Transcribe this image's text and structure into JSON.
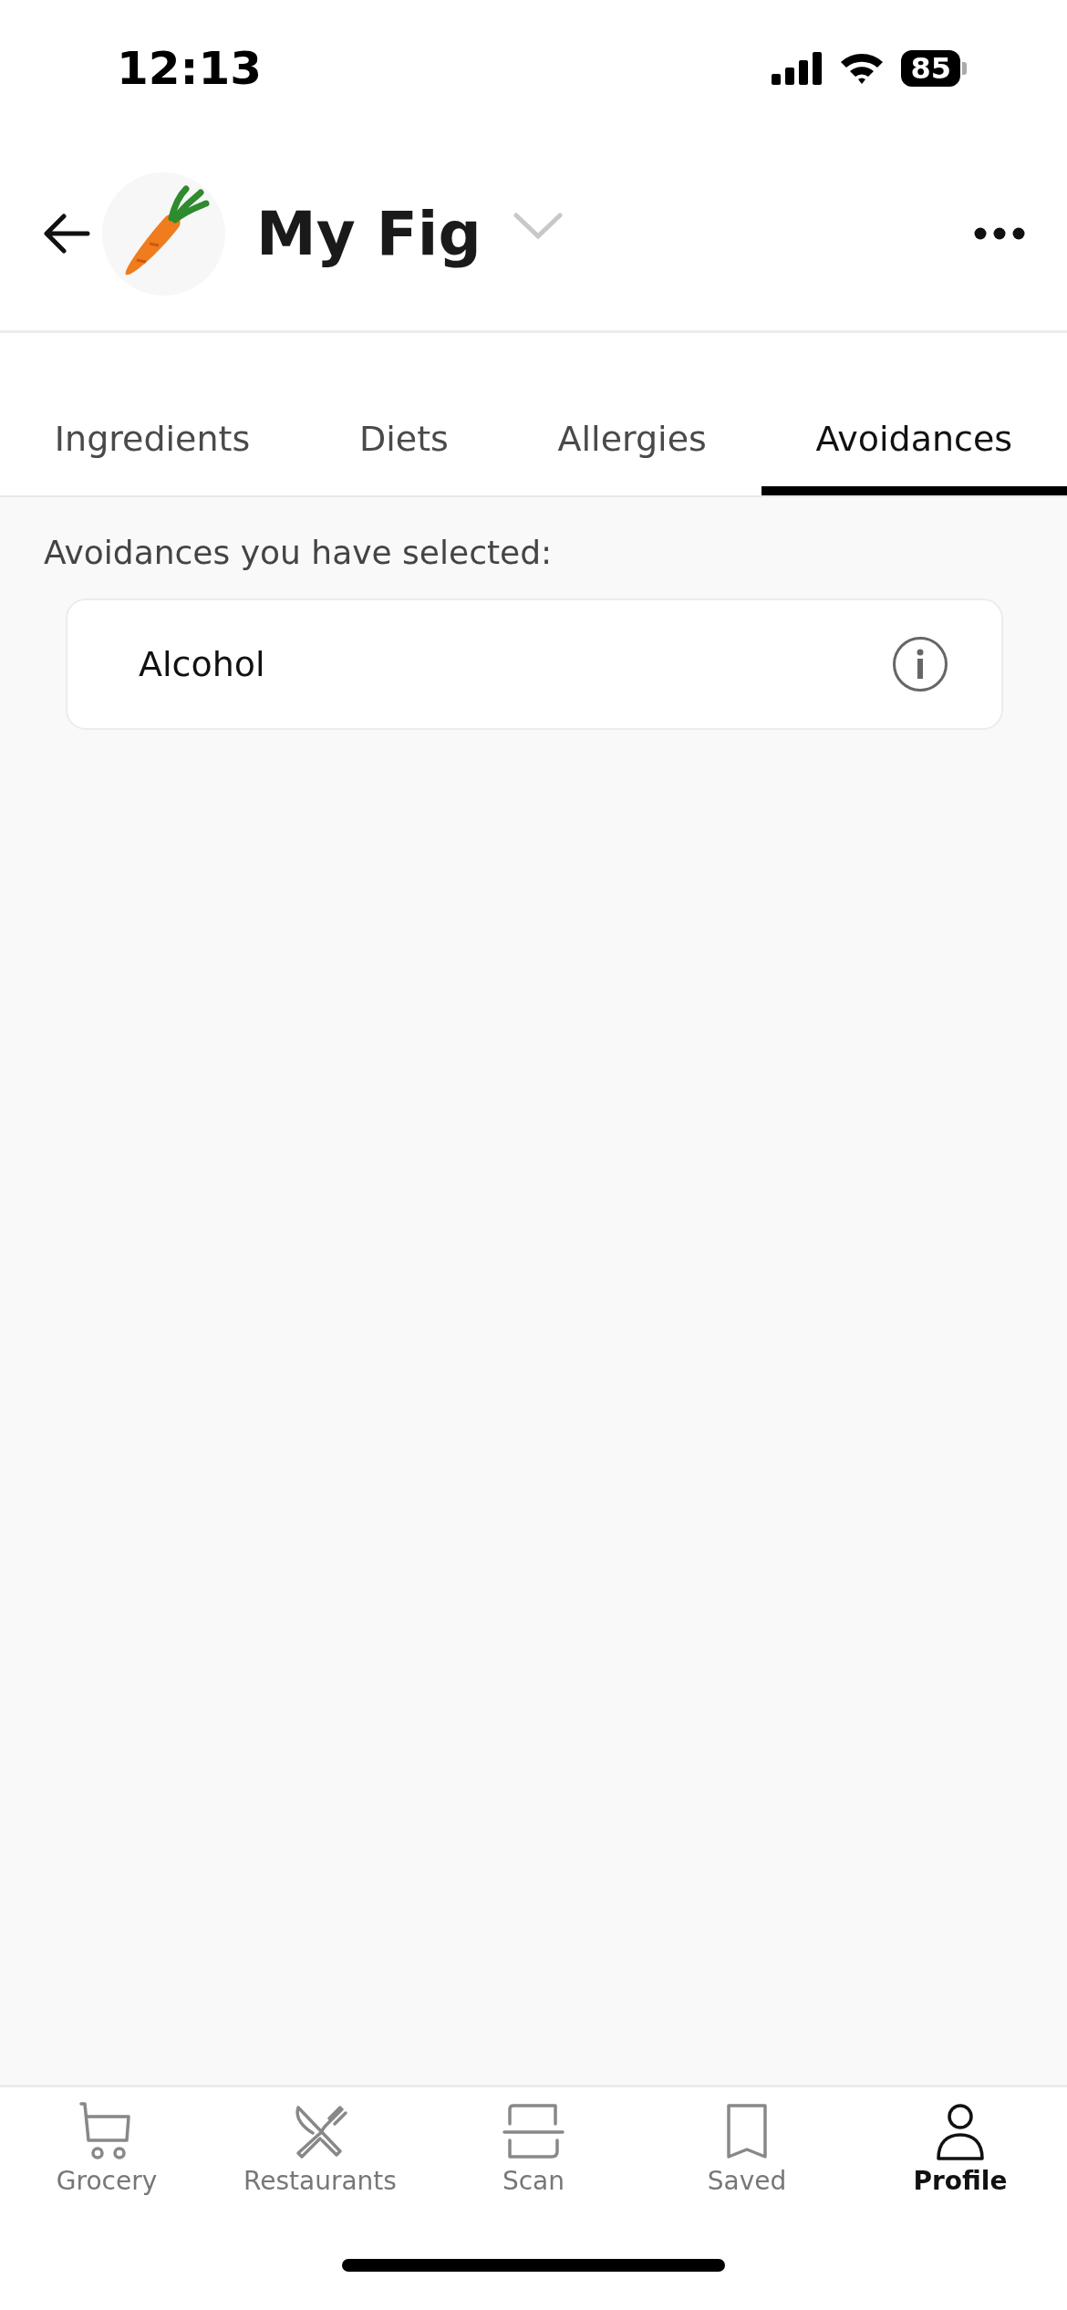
{
  "status_bar": {
    "time": "12:13",
    "battery": "85"
  },
  "header": {
    "title": "My Fig"
  },
  "tabs": [
    {
      "label": "Ingredients",
      "selected": false
    },
    {
      "label": "Diets",
      "selected": false
    },
    {
      "label": "Allergies",
      "selected": false
    },
    {
      "label": "Avoidances",
      "selected": true
    }
  ],
  "section_heading": "Avoidances you have selected:",
  "items": [
    {
      "label": "Alcohol"
    }
  ],
  "bottom_nav": [
    {
      "kind": "cart",
      "label": "Grocery",
      "selected": false
    },
    {
      "kind": "utensils",
      "label": "Restaurants",
      "selected": false
    },
    {
      "kind": "scan",
      "label": "Scan",
      "selected": false
    },
    {
      "kind": "bookmark",
      "label": "Saved",
      "selected": false
    },
    {
      "kind": "person",
      "label": "Profile",
      "selected": true
    }
  ]
}
